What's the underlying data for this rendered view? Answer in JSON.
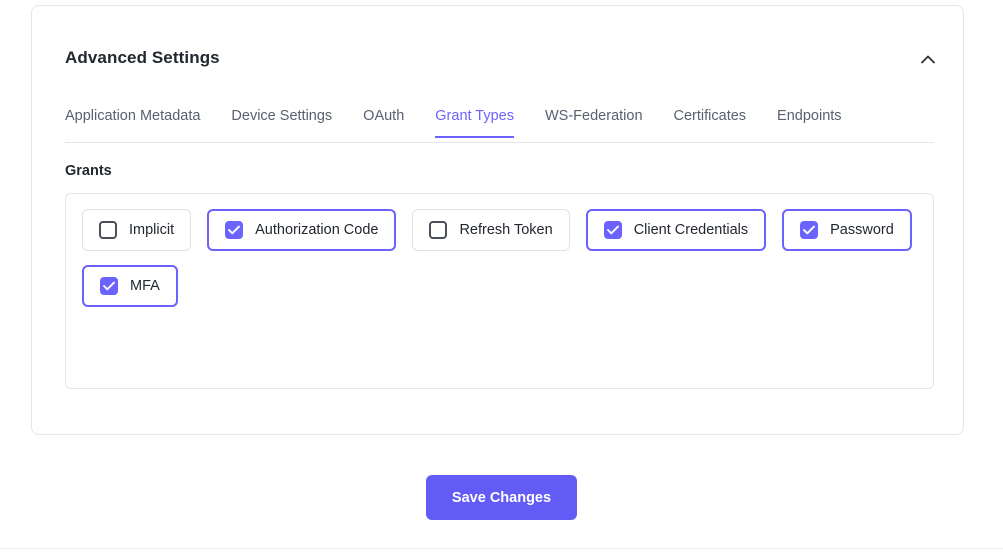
{
  "card": {
    "title": "Advanced Settings",
    "collapse_icon": "chevron-up-icon"
  },
  "tabs": [
    {
      "label": "Application Metadata",
      "active": false
    },
    {
      "label": "Device Settings",
      "active": false
    },
    {
      "label": "OAuth",
      "active": false
    },
    {
      "label": "Grant Types",
      "active": true
    },
    {
      "label": "WS-Federation",
      "active": false
    },
    {
      "label": "Certificates",
      "active": false
    },
    {
      "label": "Endpoints",
      "active": false
    }
  ],
  "grants": {
    "section_label": "Grants",
    "items": [
      {
        "label": "Implicit",
        "checked": false
      },
      {
        "label": "Authorization Code",
        "checked": true
      },
      {
        "label": "Refresh Token",
        "checked": false
      },
      {
        "label": "Client Credentials",
        "checked": true
      },
      {
        "label": "Password",
        "checked": true
      },
      {
        "label": "MFA",
        "checked": true
      }
    ]
  },
  "footer": {
    "save_label": "Save Changes"
  },
  "colors": {
    "accent": "#6c63ff",
    "button": "#635bf5",
    "text": "#23272f",
    "muted_text": "#5a6070",
    "border": "#e6e6ea"
  }
}
